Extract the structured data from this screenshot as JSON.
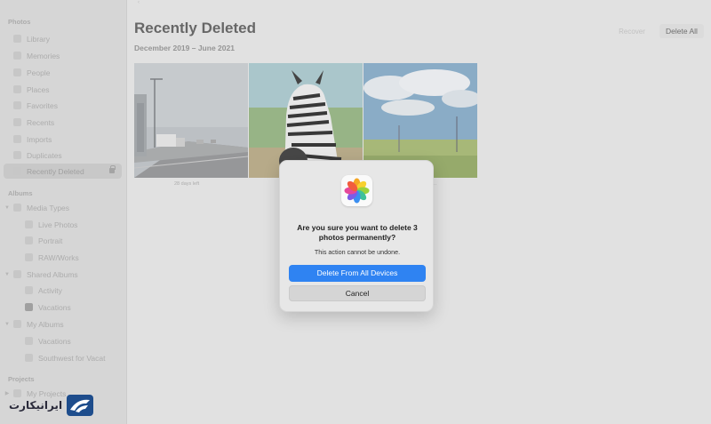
{
  "sidebar": {
    "section_photos": "Photos",
    "items_photos": [
      {
        "label": "Library",
        "icon": "library-icon"
      },
      {
        "label": "Memories",
        "icon": "memories-icon"
      },
      {
        "label": "People",
        "icon": "people-icon"
      },
      {
        "label": "Places",
        "icon": "places-icon"
      },
      {
        "label": "Favorites",
        "icon": "heart-icon"
      },
      {
        "label": "Recents",
        "icon": "clock-icon"
      },
      {
        "label": "Imports",
        "icon": "imports-icon"
      },
      {
        "label": "Duplicates",
        "icon": "duplicates-icon"
      },
      {
        "label": "Recently Deleted",
        "icon": "trash-icon",
        "selected": true
      }
    ],
    "section_albums": "Albums",
    "items_albums": [
      {
        "label": "Media Types",
        "icon": "folder-icon",
        "chevron": true
      },
      {
        "label": "Live Photos",
        "icon": "livephoto-icon",
        "indent": true
      },
      {
        "label": "Portrait",
        "icon": "portrait-icon",
        "indent": true
      },
      {
        "label": "RAW/Works",
        "icon": "raw-icon",
        "indent": true
      },
      {
        "label": "Shared Albums",
        "icon": "shared-icon",
        "chevron": true
      },
      {
        "label": "Activity",
        "icon": "activity-icon",
        "indent": true
      },
      {
        "label": "Vacations",
        "icon": "album-thumb-icon",
        "indent": true
      },
      {
        "label": "My Albums",
        "icon": "folder-icon",
        "chevron": true
      },
      {
        "label": "Vacations",
        "icon": "album-icon",
        "indent": true
      },
      {
        "label": "Southwest for Vacat",
        "icon": "album-icon",
        "indent": true
      }
    ],
    "section_projects": "Projects",
    "items_projects": [
      {
        "label": "My Projects",
        "icon": "folder-icon",
        "chevron": true
      }
    ]
  },
  "header": {
    "top_hint": "‹",
    "title": "Recently Deleted",
    "subtitle": "December 2019 – June 2021",
    "recover_label": "Recover",
    "delete_all_label": "Delete All"
  },
  "photos": [
    {
      "name": "road-photo",
      "caption": "28 days left"
    },
    {
      "name": "zebra-photo",
      "caption": ""
    },
    {
      "name": "field-photo",
      "caption": ""
    }
  ],
  "dialog": {
    "icon": "photos-app-icon",
    "title": "Are you sure you want to delete 3 photos permanently?",
    "message": "This action cannot be undone.",
    "primary_label": "Delete From All Devices",
    "cancel_label": "Cancel",
    "accent_color": "#2f83f2"
  },
  "watermark": {
    "text": "ایرانیکارت",
    "logo_color": "#1e4d8c"
  }
}
